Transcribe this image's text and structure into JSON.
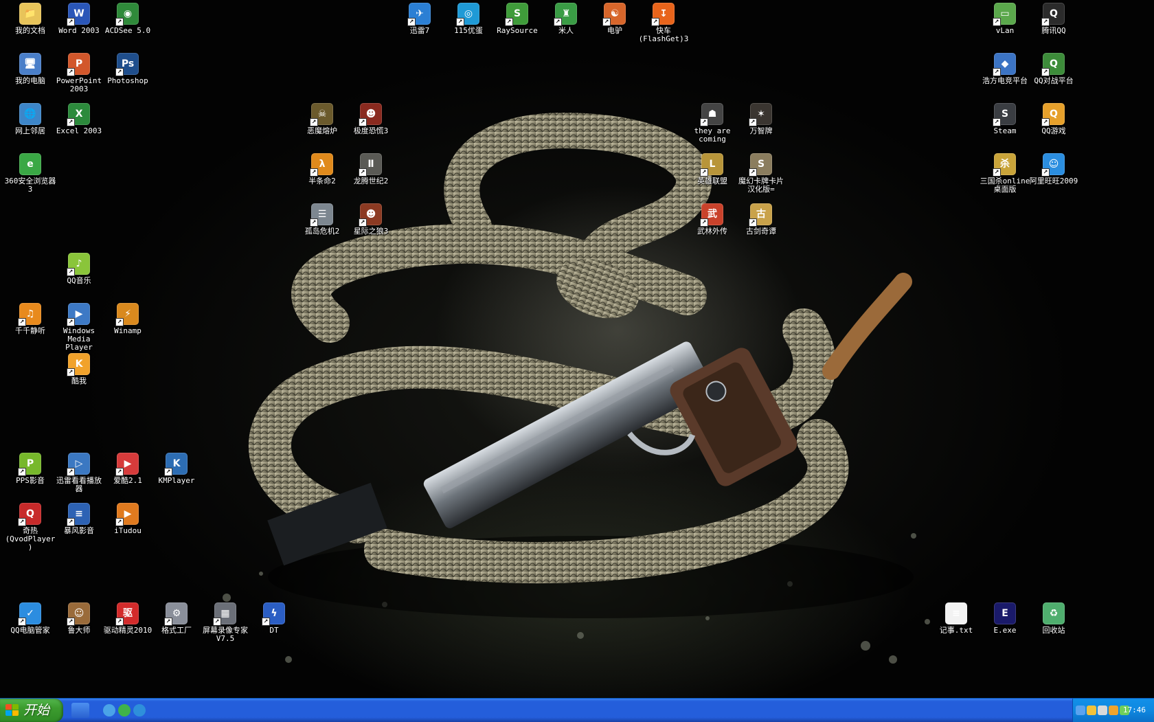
{
  "desktop": {
    "icons": [
      {
        "label": "我的文档",
        "glyph": "📁",
        "color": "#e8c45a",
        "shortcut": false
      },
      {
        "label": "Word 2003",
        "glyph": "W",
        "color": "#2a56b8",
        "shortcut": true
      },
      {
        "label": "ACDSee 5.0",
        "glyph": "◉",
        "color": "#2f8a3a",
        "shortcut": true
      },
      {
        "label": "我的电脑",
        "glyph": "🖥",
        "color": "#4a7fc9",
        "shortcut": false
      },
      {
        "label": "PowerPoint 2003",
        "glyph": "P",
        "color": "#d2572b",
        "shortcut": true
      },
      {
        "label": "Photoshop",
        "glyph": "Ps",
        "color": "#1f4e8c",
        "shortcut": true
      },
      {
        "label": "网上邻居",
        "glyph": "🌐",
        "color": "#3d86c9",
        "shortcut": false
      },
      {
        "label": "Excel 2003",
        "glyph": "X",
        "color": "#2c8a3c",
        "shortcut": true
      },
      {
        "label": "360安全浏览器 3",
        "glyph": "e",
        "color": "#3aa845",
        "shortcut": false
      },
      {
        "label": "QQ音乐",
        "glyph": "♪",
        "color": "#8ac53a",
        "shortcut": true
      },
      {
        "label": "千千静听",
        "glyph": "♫",
        "color": "#e88a1d",
        "shortcut": true
      },
      {
        "label": "Windows Media Player",
        "glyph": "▶",
        "color": "#3d79c5",
        "shortcut": true
      },
      {
        "label": "Winamp",
        "glyph": "⚡",
        "color": "#d9891e",
        "shortcut": true
      },
      {
        "label": "酷我",
        "glyph": "K",
        "color": "#f1a22b",
        "shortcut": true
      },
      {
        "label": "PPS影音",
        "glyph": "P",
        "color": "#77b82b",
        "shortcut": true
      },
      {
        "label": "迅雷看看播放器",
        "glyph": "▷",
        "color": "#3b78c2",
        "shortcut": true
      },
      {
        "label": "爱酷2.1",
        "glyph": "▶",
        "color": "#d63b3b",
        "shortcut": true
      },
      {
        "label": "KMPlayer",
        "glyph": "K",
        "color": "#2d6db3",
        "shortcut": true
      },
      {
        "label": "奇热(QvodPlayer)",
        "glyph": "Q",
        "color": "#c72a2a",
        "shortcut": true
      },
      {
        "label": "暴风影音",
        "glyph": "≡",
        "color": "#2d62b4",
        "shortcut": true
      },
      {
        "label": "iTudou",
        "glyph": "▶",
        "color": "#e07a1f",
        "shortcut": true
      },
      {
        "label": "QQ电脑管家",
        "glyph": "✓",
        "color": "#2c8de0",
        "shortcut": true
      },
      {
        "label": "鲁大师",
        "glyph": "☺",
        "color": "#9a6b3a",
        "shortcut": true
      },
      {
        "label": "驱动精灵2010",
        "glyph": "驱",
        "color": "#d22b2b",
        "shortcut": true
      },
      {
        "label": "格式工厂",
        "glyph": "⚙",
        "color": "#8a8f9a",
        "shortcut": true
      },
      {
        "label": "屏幕录像专家 V7.5",
        "glyph": "▦",
        "color": "#6b6f78",
        "shortcut": true
      },
      {
        "label": "DT",
        "glyph": "ϟ",
        "color": "#2b5ec4",
        "shortcut": true
      },
      {
        "label": "迅雷7",
        "glyph": "✈",
        "color": "#2b7fd4",
        "shortcut": true
      },
      {
        "label": "115优蛋",
        "glyph": "◎",
        "color": "#1f9ad6",
        "shortcut": true
      },
      {
        "label": "RaySource",
        "glyph": "S",
        "color": "#3f9c3a",
        "shortcut": true
      },
      {
        "label": "米人",
        "glyph": "♜",
        "color": "#3a9c45",
        "shortcut": true
      },
      {
        "label": "电驴",
        "glyph": "☯",
        "color": "#d7662b",
        "shortcut": true
      },
      {
        "label": "快车(FlashGet)3",
        "glyph": "↧",
        "color": "#e8641b",
        "shortcut": true
      },
      {
        "label": "恶魔熔炉",
        "glyph": "☠",
        "color": "#6b5a2c",
        "shortcut": true
      },
      {
        "label": "极度恐慌3",
        "glyph": "☻",
        "color": "#8a2a1f",
        "shortcut": true
      },
      {
        "label": "半条命2",
        "glyph": "λ",
        "color": "#e08a1c",
        "shortcut": true
      },
      {
        "label": "龙腾世纪2",
        "glyph": "Ⅱ",
        "color": "#5a5a55",
        "shortcut": true
      },
      {
        "label": "孤岛危机2",
        "glyph": "☰",
        "color": "#7d8790",
        "shortcut": true
      },
      {
        "label": "星际之狼3",
        "glyph": "☻",
        "color": "#8c3a22",
        "shortcut": true
      },
      {
        "label": "they are coming",
        "glyph": "☗",
        "color": "#444444",
        "shortcut": true
      },
      {
        "label": "万智牌",
        "glyph": "✶",
        "color": "#3a3530",
        "shortcut": true
      },
      {
        "label": "英雄联盟",
        "glyph": "L",
        "color": "#b8953a",
        "shortcut": true
      },
      {
        "label": "魔幻卡牌卡片汉化版=",
        "glyph": "S",
        "color": "#8b7d5e",
        "shortcut": true
      },
      {
        "label": "武林外传",
        "glyph": "武",
        "color": "#c9422b",
        "shortcut": true
      },
      {
        "label": "古剑奇谭",
        "glyph": "古",
        "color": "#c9a24a",
        "shortcut": true
      },
      {
        "label": "vLan",
        "glyph": "▭",
        "color": "#5ba84c",
        "shortcut": true
      },
      {
        "label": "腾讯QQ",
        "glyph": "Q",
        "color": "#2b2b2b",
        "shortcut": true
      },
      {
        "label": "浩方电竞平台",
        "glyph": "◆",
        "color": "#3c74c4",
        "shortcut": true
      },
      {
        "label": "QQ对战平台",
        "glyph": "Q",
        "color": "#3d8c3a",
        "shortcut": true
      },
      {
        "label": "Steam",
        "glyph": "S",
        "color": "#3a3d42",
        "shortcut": true
      },
      {
        "label": "QQ游戏",
        "glyph": "Q",
        "color": "#e6a02b",
        "shortcut": true
      },
      {
        "label": "三国杀online桌面版",
        "glyph": "杀",
        "color": "#c9a43a",
        "shortcut": true
      },
      {
        "label": "阿里旺旺2009",
        "glyph": "☺",
        "color": "#2b8ee0",
        "shortcut": true
      },
      {
        "label": "记事.txt",
        "glyph": "≡",
        "color": "#f2f2f2",
        "shortcut": false
      },
      {
        "label": "E.exe",
        "glyph": "E",
        "color": "#1a1a6a",
        "shortcut": false
      },
      {
        "label": "回收站",
        "glyph": "♻",
        "color": "#4fae6e",
        "shortcut": false
      }
    ]
  },
  "taskbar": {
    "start_label": "开始",
    "quick_launch": [
      {
        "name": "ie-icon",
        "color": "#4aa3e8"
      },
      {
        "name": "explorer-icon",
        "color": "#3fb34a"
      },
      {
        "name": "media-icon",
        "color": "#2e8fdb"
      }
    ],
    "tray_icons": [
      {
        "name": "collapse-arrow-icon",
        "color": "#5aa3ef"
      },
      {
        "name": "qq-tray-icon",
        "color": "#f2c23a"
      },
      {
        "name": "volume-icon",
        "color": "#d9d9d9"
      },
      {
        "name": "shield-tray-icon",
        "color": "#f0a42c"
      },
      {
        "name": "network-tray-icon",
        "color": "#6fcf5b"
      }
    ],
    "clock": "17:46"
  }
}
